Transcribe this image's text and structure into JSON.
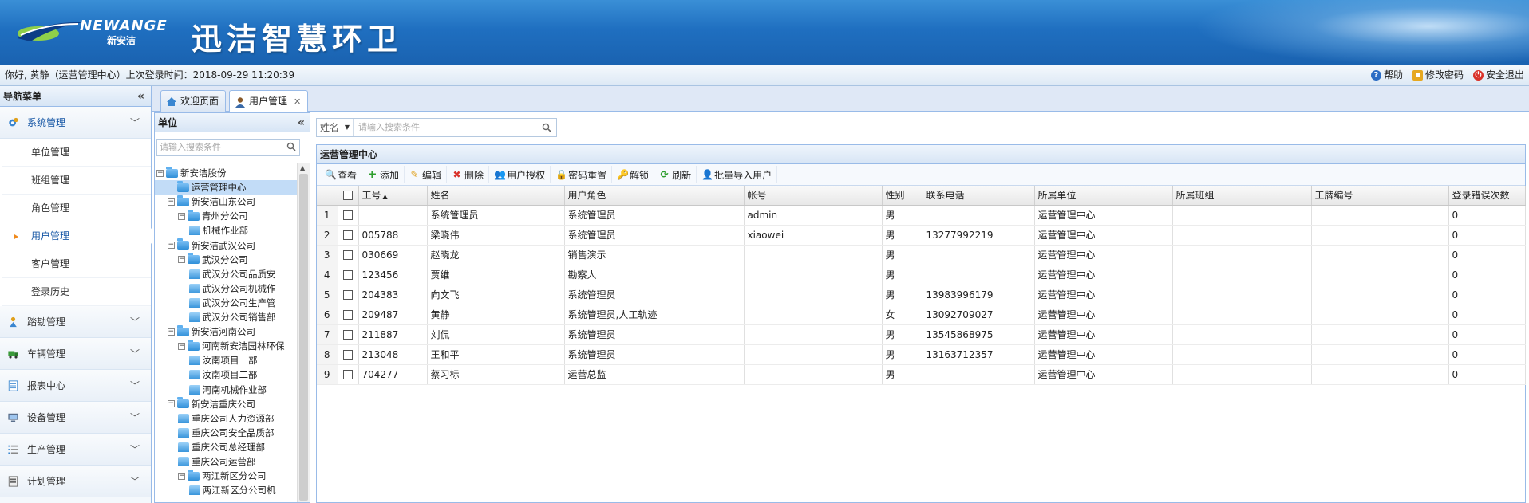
{
  "banner": {
    "logo_text": "NEWANGE",
    "logo_sub": "新安洁",
    "app_title": "迅洁智慧环卫"
  },
  "infobar": {
    "greeting": "你好, 黄静（运营管理中心）上次登录时间：2018-09-29 11:20:39",
    "help": "帮助",
    "change_password": "修改密码",
    "logout": "安全退出"
  },
  "nav": {
    "title": "导航菜单",
    "groups": [
      {
        "label": "系统管理",
        "icon": "gear-icon",
        "items": [
          "单位管理",
          "班组管理",
          "角色管理",
          "用户管理",
          "客户管理",
          "登录历史"
        ]
      },
      {
        "label": "踏勘管理",
        "icon": "survey-icon"
      },
      {
        "label": "车辆管理",
        "icon": "truck-icon"
      },
      {
        "label": "报表中心",
        "icon": "report-icon"
      },
      {
        "label": "设备管理",
        "icon": "monitor-icon"
      },
      {
        "label": "生产管理",
        "icon": "list-icon"
      },
      {
        "label": "计划管理",
        "icon": "plan-icon"
      }
    ]
  },
  "tabs": [
    {
      "label": "欢迎页面",
      "icon": "home-icon"
    },
    {
      "label": "用户管理",
      "icon": "user-icon",
      "active": true
    }
  ],
  "unit_panel": {
    "title": "单位",
    "search_placeholder": "请输入搜索条件",
    "tree": [
      {
        "label": "新安洁股份",
        "level": 0,
        "type": "folder"
      },
      {
        "label": "运营管理中心",
        "level": 1,
        "type": "folder",
        "selected": true
      },
      {
        "label": "新安洁山东公司",
        "level": 1,
        "type": "folder"
      },
      {
        "label": "青州分公司",
        "level": 2,
        "type": "folder"
      },
      {
        "label": "机械作业部",
        "level": 3,
        "type": "leaf"
      },
      {
        "label": "新安洁武汉公司",
        "level": 1,
        "type": "folder"
      },
      {
        "label": "武汉分公司",
        "level": 2,
        "type": "folder"
      },
      {
        "label": "武汉分公司品质安",
        "level": 3,
        "type": "leaf"
      },
      {
        "label": "武汉分公司机械作",
        "level": 3,
        "type": "leaf"
      },
      {
        "label": "武汉分公司生产管",
        "level": 3,
        "type": "leaf"
      },
      {
        "label": "武汉分公司销售部",
        "level": 3,
        "type": "leaf"
      },
      {
        "label": "新安洁河南公司",
        "level": 1,
        "type": "folder"
      },
      {
        "label": "河南新安洁园林环保",
        "level": 2,
        "type": "folder"
      },
      {
        "label": "汝南项目一部",
        "level": 3,
        "type": "leaf"
      },
      {
        "label": "汝南项目二部",
        "level": 3,
        "type": "leaf"
      },
      {
        "label": "河南机械作业部",
        "level": 3,
        "type": "leaf"
      },
      {
        "label": "新安洁重庆公司",
        "level": 1,
        "type": "folder"
      },
      {
        "label": "重庆公司人力资源部",
        "level": 2,
        "type": "leaf"
      },
      {
        "label": "重庆公司安全品质部",
        "level": 2,
        "type": "leaf"
      },
      {
        "label": "重庆公司总经理部",
        "level": 2,
        "type": "leaf"
      },
      {
        "label": "重庆公司运营部",
        "level": 2,
        "type": "leaf"
      },
      {
        "label": "两江新区分公司",
        "level": 2,
        "type": "folder"
      },
      {
        "label": "两江新区分公司机",
        "level": 3,
        "type": "leaf"
      }
    ]
  },
  "search": {
    "field": "姓名",
    "placeholder": "请输入搜索条件"
  },
  "grid": {
    "title": "运营管理中心",
    "toolbar": [
      {
        "label": "查看",
        "icon": "magnifier-icon",
        "color": "#3a7bd5"
      },
      {
        "label": "添加",
        "icon": "plus-icon",
        "color": "#2e9e2e"
      },
      {
        "label": "编辑",
        "icon": "pencil-icon",
        "color": "#e0a01c"
      },
      {
        "label": "删除",
        "icon": "delete-icon",
        "color": "#d9322a"
      },
      {
        "label": "用户授权",
        "icon": "users-key-icon",
        "color": "#3a7bd5"
      },
      {
        "label": "密码重置",
        "icon": "lock-icon",
        "color": "#e0a01c"
      },
      {
        "label": "解锁",
        "icon": "unlock-icon",
        "color": "#e0a01c"
      },
      {
        "label": "刷新",
        "icon": "refresh-icon",
        "color": "#2e9e2e"
      },
      {
        "label": "批量导入用户",
        "icon": "import-users-icon",
        "color": "#3a7bd5"
      }
    ],
    "columns": [
      "工号",
      "姓名",
      "用户角色",
      "帐号",
      "性别",
      "联系电话",
      "所属单位",
      "所属班组",
      "工牌编号",
      "登录错误次数"
    ],
    "rows": [
      [
        "",
        "系统管理员",
        "系统管理员",
        "admin",
        "男",
        "",
        "运营管理中心",
        "",
        "",
        "0"
      ],
      [
        "005788",
        "梁晓伟",
        "系统管理员",
        "xiaowei",
        "男",
        "13277992219",
        "运营管理中心",
        "",
        "",
        "0"
      ],
      [
        "030669",
        "赵晓龙",
        "销售演示",
        "",
        "男",
        "",
        "运营管理中心",
        "",
        "",
        "0"
      ],
      [
        "123456",
        "贾维",
        "勘察人",
        "",
        "男",
        "",
        "运营管理中心",
        "",
        "",
        "0"
      ],
      [
        "204383",
        "向文飞",
        "系统管理员",
        "",
        "男",
        "13983996179",
        "运营管理中心",
        "",
        "",
        "0"
      ],
      [
        "209487",
        "黄静",
        "系统管理员,人工轨迹",
        "",
        "女",
        "13092709027",
        "运营管理中心",
        "",
        "",
        "0"
      ],
      [
        "211887",
        "刘侃",
        "系统管理员",
        "",
        "男",
        "13545868975",
        "运营管理中心",
        "",
        "",
        "0"
      ],
      [
        "213048",
        "王和平",
        "系统管理员",
        "",
        "男",
        "13163712357",
        "运营管理中心",
        "",
        "",
        "0"
      ],
      [
        "704277",
        "蔡习标",
        "运营总监",
        "",
        "男",
        "",
        "运营管理中心",
        "",
        "",
        "0"
      ]
    ]
  }
}
